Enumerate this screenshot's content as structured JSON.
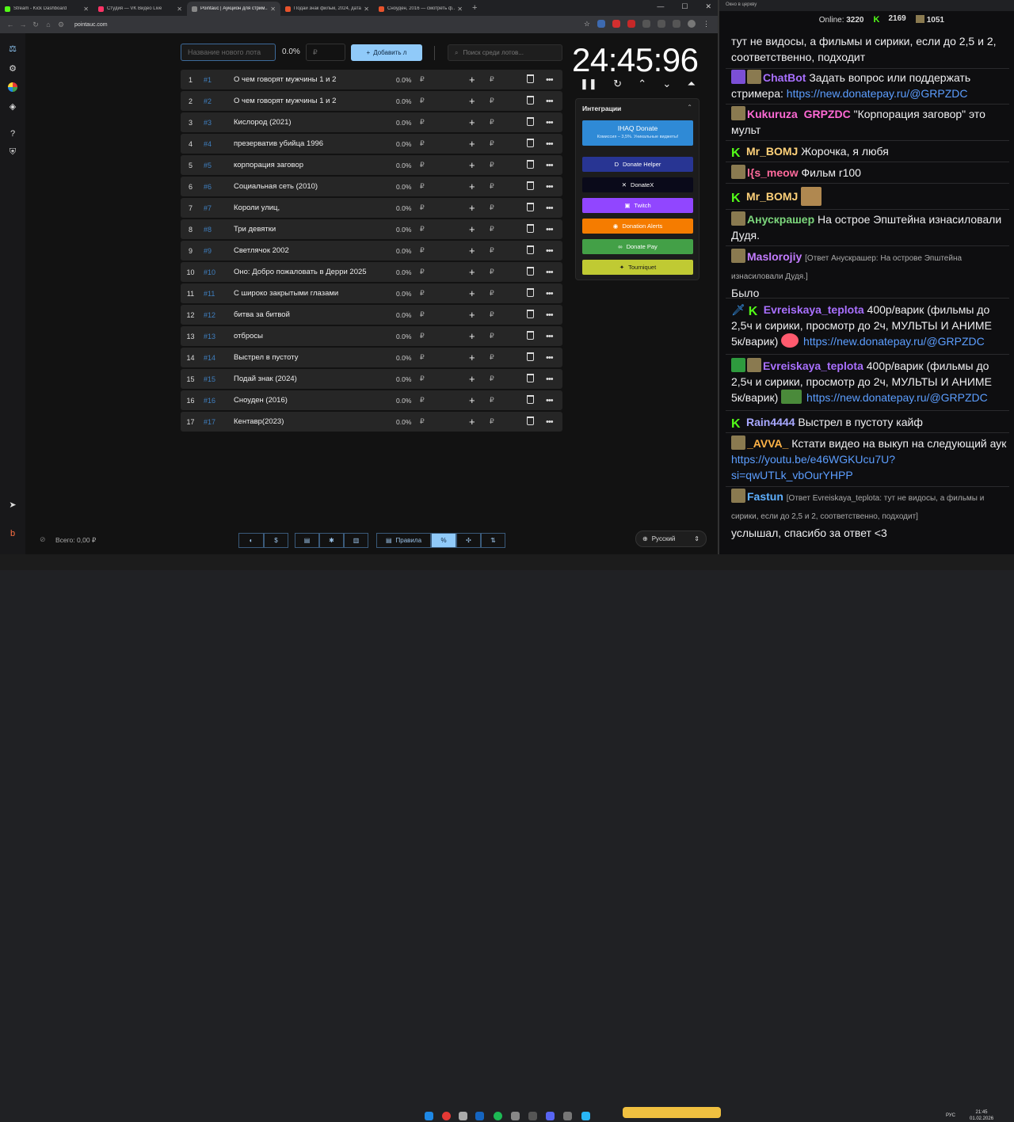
{
  "browser": {
    "tabs": [
      {
        "title": "Stream - Kick Dashboard",
        "color": "#53fc18"
      },
      {
        "title": "Студия — VK Видео Live",
        "color": "#ff3366"
      },
      {
        "title": "Pointauc | Аукцион для стрим...",
        "color": "#888888",
        "active": true
      },
      {
        "title": "Подай знак фильм, 2024, дата...",
        "color": "#e8532c"
      },
      {
        "title": "Сноуден, 2016 — смотреть ф...",
        "color": "#e8532c"
      }
    ],
    "url": "pointauc.com"
  },
  "controls": {
    "new_lot_placeholder": "Название нового лота",
    "percent": "0.0%",
    "amount_placeholder": "₽",
    "add_label": "Добавить л",
    "search_placeholder": "Поиск среди лотов..."
  },
  "lots": [
    {
      "n": "1",
      "id": "#1",
      "name": "О чем говорят мужчины 1 и 2",
      "pct": "0.0%"
    },
    {
      "n": "2",
      "id": "#2",
      "name": "О чем говорят мужчины 1 и 2",
      "pct": "0.0%"
    },
    {
      "n": "3",
      "id": "#3",
      "name": "Кислород (2021)",
      "pct": "0.0%"
    },
    {
      "n": "4",
      "id": "#4",
      "name": "презерватив убийца 1996",
      "pct": "0.0%"
    },
    {
      "n": "5",
      "id": "#5",
      "name": "корпорация заговор",
      "pct": "0.0%"
    },
    {
      "n": "6",
      "id": "#6",
      "name": "Социальная сеть (2010)",
      "pct": "0.0%"
    },
    {
      "n": "7",
      "id": "#7",
      "name": "Короли улиц,",
      "pct": "0.0%"
    },
    {
      "n": "8",
      "id": "#8",
      "name": "Три девятки",
      "pct": "0.0%"
    },
    {
      "n": "9",
      "id": "#9",
      "name": "Светлячок 2002",
      "pct": "0.0%"
    },
    {
      "n": "10",
      "id": "#10",
      "name": "Оно: Добро пожаловать в Дерри 2025",
      "pct": "0.0%"
    },
    {
      "n": "11",
      "id": "#11",
      "name": "С широко закрытыми глазами",
      "pct": "0.0%"
    },
    {
      "n": "12",
      "id": "#12",
      "name": "битва за битвой",
      "pct": "0.0%"
    },
    {
      "n": "13",
      "id": "#13",
      "name": "отбросы",
      "pct": "0.0%"
    },
    {
      "n": "14",
      "id": "#14",
      "name": "Выстрел в пустоту",
      "pct": "0.0%"
    },
    {
      "n": "15",
      "id": "#15",
      "name": "Подай знак (2024)",
      "pct": "0.0%"
    },
    {
      "n": "16",
      "id": "#16",
      "name": "Сноуден (2016)",
      "pct": "0.0%"
    },
    {
      "n": "17",
      "id": "#17",
      "name": "Кентавр(2023)",
      "pct": "0.0%"
    }
  ],
  "currency": "₽",
  "timer": "24:45:96",
  "integrations": {
    "title": "Интеграции",
    "ihaq": {
      "label": "IHAQ Donate",
      "sub": "Комиссия – 3,5%. Уникальные виджеты!"
    },
    "buttons": [
      {
        "label": "Donate Helper",
        "bg": "#283593",
        "fg": "#ffffff",
        "icon": "D"
      },
      {
        "label": "DonateX",
        "bg": "#0a0a1a",
        "fg": "#ffffff",
        "icon": "✕"
      },
      {
        "label": "Twitch",
        "bg": "#9146ff",
        "fg": "#ffffff",
        "icon": "▣"
      },
      {
        "label": "Donation Alerts",
        "bg": "#f57c00",
        "fg": "#ffffff",
        "icon": "◉"
      },
      {
        "label": "Donate Pay",
        "bg": "#43a047",
        "fg": "#ffffff",
        "icon": "∞"
      },
      {
        "label": "Tourniquet",
        "bg": "#c0ca33",
        "fg": "#1a1a1a",
        "icon": "✦"
      }
    ]
  },
  "footer": {
    "total": "Всего: 0,00 ₽",
    "rules_label": "Правила",
    "language": "Русский"
  },
  "chat": {
    "header": "Окно в церкву",
    "online_label": "Online:",
    "online": "3220",
    "kick_count": "2169",
    "vk_count": "1051",
    "messages": [
      {
        "user": "",
        "color": "#efeff1",
        "text": "тут не видосы, а фильмы и сирики, если до 2,5 и 2, соответственно, подходит"
      },
      {
        "user": "ChatBot",
        "color": "#a970ff",
        "text": "Задать вопрос или поддержать стримера:",
        "link": "https://new.donatepay.ru/@GRPZDC"
      },
      {
        "user": "Kukuruza",
        "user2": "GRPZDC",
        "color": "#ff6ad5",
        "text": "\"Корпорация заговор\" это мульт"
      },
      {
        "user": "Mr_BOMJ",
        "color": "#ffd27a",
        "text": "Жорочка, я любя"
      },
      {
        "user": "l{s_meow",
        "color": "#ff6a9c",
        "text": "Фильм r100"
      },
      {
        "user": "Mr_BOMJ",
        "color": "#ffd27a",
        "text": ""
      },
      {
        "user": "Анускрашер",
        "color": "#7cd67c",
        "text": "На острое Эпштейна изнасиловали Дудя."
      },
      {
        "user": "Maslorojiy",
        "color": "#c37cff",
        "reply": "[Ответ Анускрашер: На острове Эпштейна изнасиловали Дудя.]",
        "text": "Было"
      },
      {
        "user": "Evreiskaya_teplota",
        "color": "#a970ff",
        "text": "400р/варик (фильмы до 2,5ч и сирики, просмотр до 2ч, МУЛЬТЫ И АНИМЕ 5к/варик)",
        "link": "https://new.donatepay.ru/@GRPZDC"
      },
      {
        "user": "Evreiskaya_teplota",
        "color": "#a970ff",
        "text": "400р/варик (фильмы до 2,5ч и сирики, просмотр до 2ч, МУЛЬТЫ И АНИМЕ 5к/варик)",
        "link": "https://new.donatepay.ru/@GRPZDC"
      },
      {
        "user": "Rain4444",
        "color": "#a8a8ff",
        "text": "Выстрел в пустоту кайф"
      },
      {
        "user": "_AVVA_",
        "color": "#ffb347",
        "text": "Кстати видео на выкуп на следующий аук",
        "link": "https://youtu.be/e46WGKUcu7U?si=qwUTLk_vbOurYHPP"
      },
      {
        "user": "Fastun",
        "color": "#5fb0ff",
        "reply": "[Ответ Evreiskaya_teplota: тут не видосы, а фильмы и сирики, если до 2,5 и 2, соответственно, подходит]",
        "text": "услышал, спасибо за ответ <3"
      }
    ]
  },
  "taskbar": {
    "time": "21:45",
    "date": "01.02.2026",
    "lang": "РУС"
  }
}
